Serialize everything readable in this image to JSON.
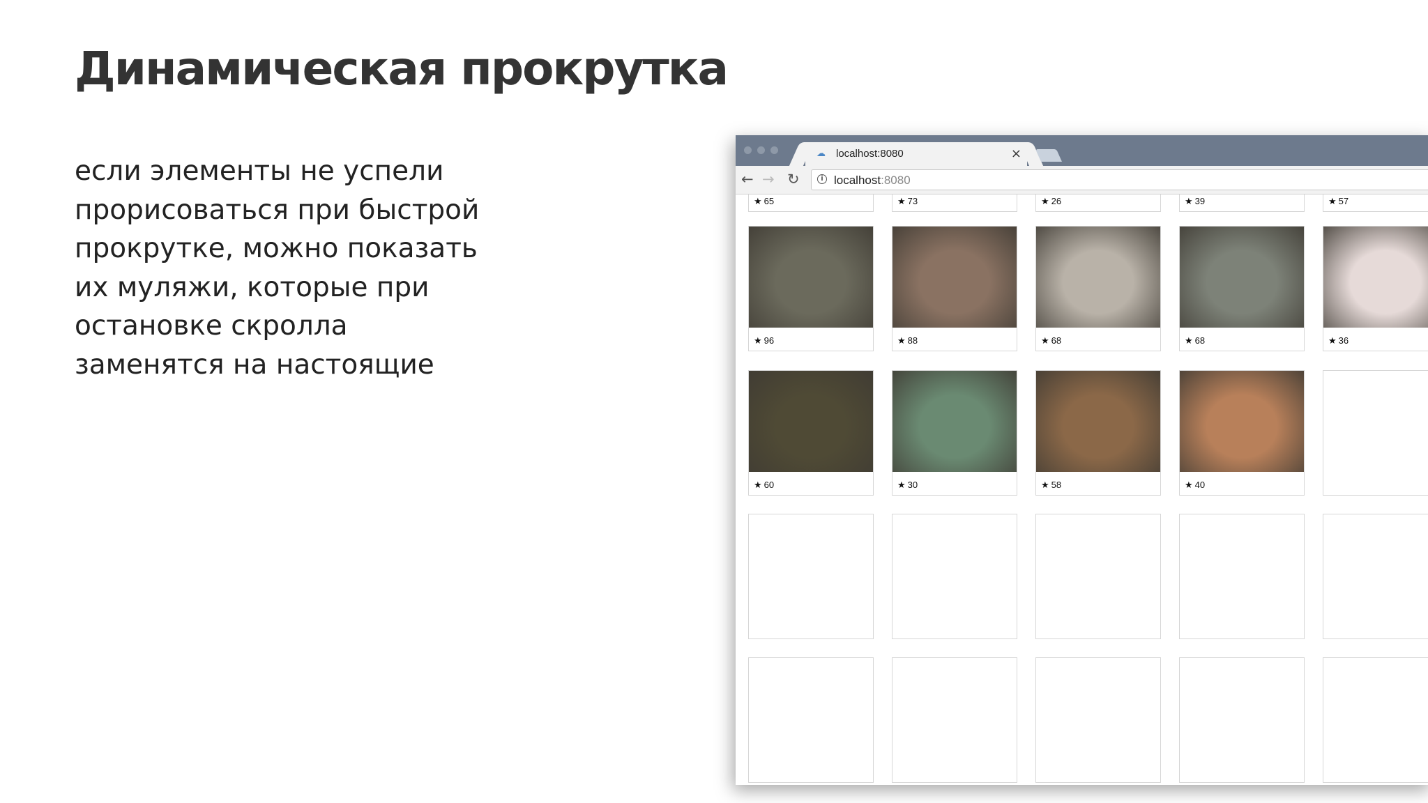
{
  "slide": {
    "title": "Динамическая прокрутка",
    "body_lines": [
      "если элементы не успели",
      "прорисоваться при быстрой",
      "прокрутке, можно показать",
      "их муляжи, которые при",
      "остановке скролла",
      "заменятся на настоящие"
    ]
  },
  "browser": {
    "tab_title": "localhost:8080",
    "tab_close": "×",
    "favicon": "cloud-icon",
    "address_host": "localhost",
    "address_port": ":8080",
    "nav": {
      "back": "←",
      "forward": "→",
      "reload": "↻",
      "info": "i"
    }
  },
  "gallery": {
    "star": "★",
    "rows": [
      {
        "state": "loaded",
        "items": [
          {
            "rating": "65"
          },
          {
            "rating": "73"
          },
          {
            "rating": "26"
          },
          {
            "rating": "39"
          },
          {
            "rating": "57"
          }
        ]
      },
      {
        "state": "loaded",
        "items": [
          {
            "rating": "96",
            "color": "#6b6a5c"
          },
          {
            "rating": "88",
            "color": "#8a7262"
          },
          {
            "rating": "68",
            "color": "#b9b2a8"
          },
          {
            "rating": "68",
            "color": "#7d8278"
          },
          {
            "rating": "36",
            "color": "#e6dad8"
          }
        ]
      },
      {
        "state": "loaded",
        "items": [
          {
            "rating": "60",
            "color": "#4f4a35"
          },
          {
            "rating": "30",
            "color": "#6a8a72"
          },
          {
            "rating": "58",
            "color": "#8b6848"
          },
          {
            "rating": "40",
            "color": "#b8805a"
          },
          {
            "rating": "",
            "placeholder": true
          }
        ]
      },
      {
        "state": "placeholder",
        "items": [
          {},
          {},
          {},
          {},
          {}
        ]
      },
      {
        "state": "placeholder",
        "items": [
          {},
          {},
          {},
          {},
          {}
        ]
      }
    ]
  }
}
